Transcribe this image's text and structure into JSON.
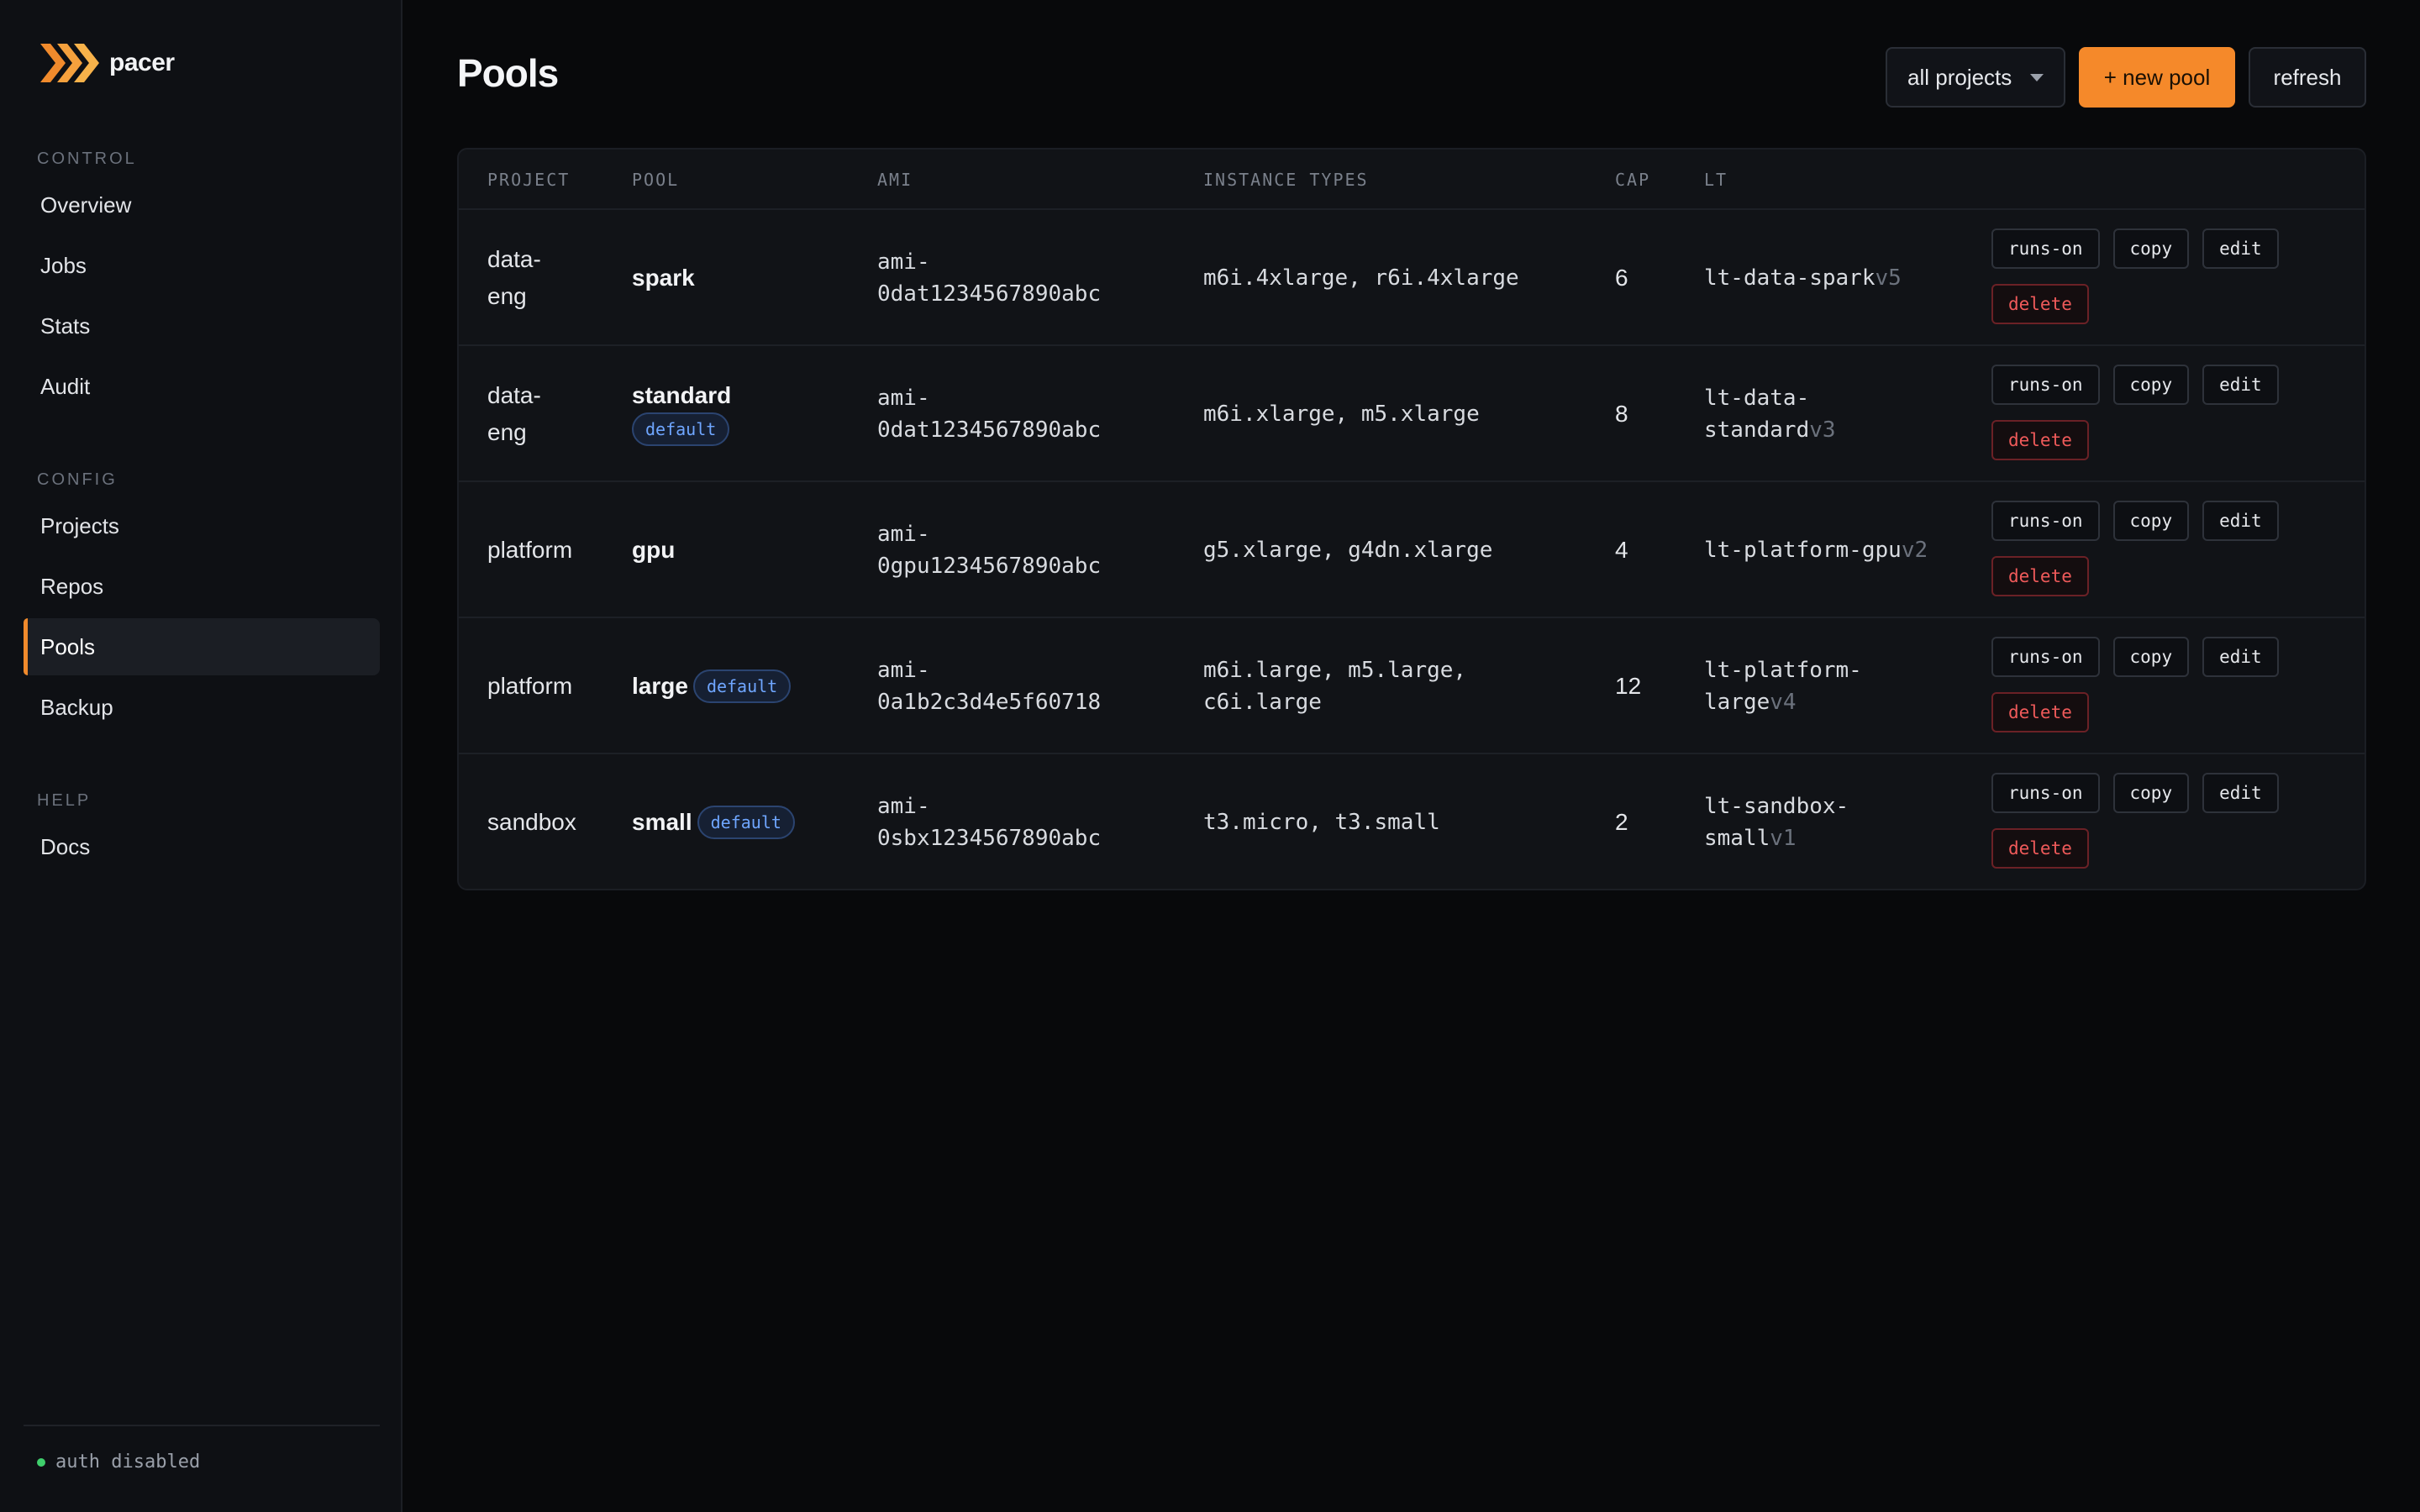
{
  "brand": {
    "name": "pacer",
    "icon": "chevron-logo-icon",
    "accent": "#f5892a"
  },
  "sidebar": {
    "sections": [
      {
        "heading": "CONTROL",
        "items": [
          "Overview",
          "Jobs",
          "Stats",
          "Audit"
        ]
      },
      {
        "heading": "CONFIG",
        "items": [
          "Projects",
          "Repos",
          "Pools",
          "Backup"
        ]
      },
      {
        "heading": "HELP",
        "items": [
          "Docs"
        ]
      }
    ],
    "active_item": "Pools",
    "footer_status": "auth disabled"
  },
  "header": {
    "title": "Pools",
    "project_filter": "all projects",
    "new_pool_label": "+ new pool",
    "refresh_label": "refresh"
  },
  "table": {
    "columns": [
      "PROJECT",
      "POOL",
      "AMI",
      "INSTANCE TYPES",
      "CAP",
      "LT"
    ],
    "actions": {
      "runs_on": "runs-on",
      "copy": "copy",
      "edit": "edit",
      "delete": "delete"
    },
    "rows": [
      {
        "project": "data-\neng",
        "pool": "spark",
        "badge": "",
        "ami": "ami-\n0dat1234567890abc",
        "types": "m6i.4xlarge, r6i.4xlarge",
        "cap": "6",
        "lt": "lt-data-spark",
        "lt_version": "v5"
      },
      {
        "project": "data-\neng",
        "pool": "standard",
        "badge": "default",
        "ami": "ami-\n0dat1234567890abc",
        "types": "m6i.xlarge, m5.xlarge",
        "cap": "8",
        "lt": "lt-data-\nstandard",
        "lt_version": "v3"
      },
      {
        "project": "platform",
        "pool": "gpu",
        "badge": "",
        "ami": "ami-\n0gpu1234567890abc",
        "types": "g5.xlarge, g4dn.xlarge",
        "cap": "4",
        "lt": "lt-platform-gpu",
        "lt_version": "v2"
      },
      {
        "project": "platform",
        "pool": "large",
        "badge": "default",
        "ami": "ami-\n0a1b2c3d4e5f60718",
        "types": "m6i.large, m5.large,\nc6i.large",
        "cap": "12",
        "lt": "lt-platform-\nlarge",
        "lt_version": "v4"
      },
      {
        "project": "sandbox",
        "pool": "small",
        "badge": "default",
        "ami": "ami-\n0sbx1234567890abc",
        "types": "t3.micro, t3.small",
        "cap": "2",
        "lt": "lt-sandbox-\nsmall",
        "lt_version": "v1"
      }
    ]
  }
}
